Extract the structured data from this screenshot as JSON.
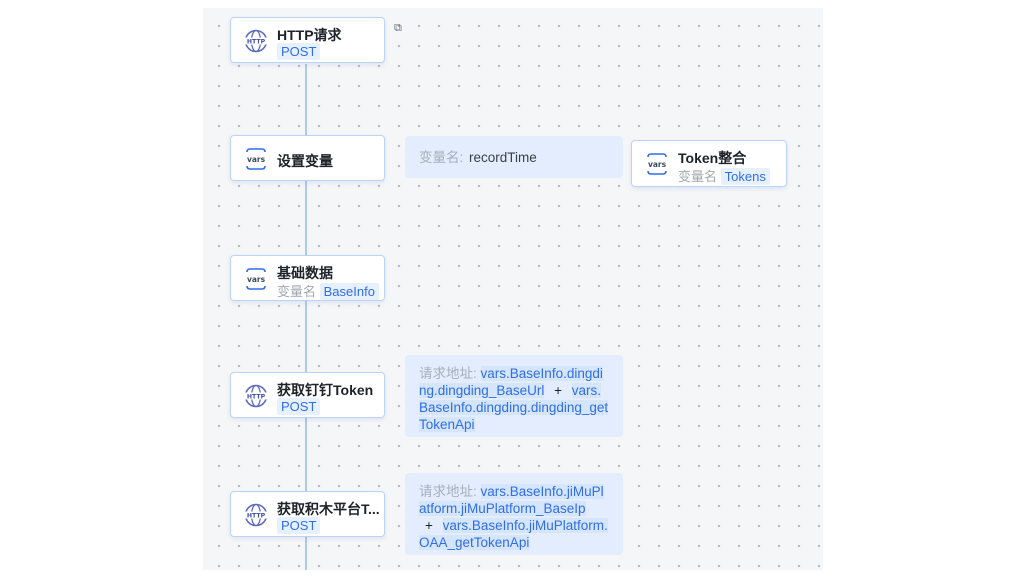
{
  "canvas": {
    "background": "#f5f6f7",
    "accent": "#2f6ee6"
  },
  "nodes": {
    "http_request": {
      "title": "HTTP请求",
      "method": "POST",
      "icon": "http-globe-icon"
    },
    "set_variable": {
      "title": "设置变量",
      "icon": "vars-icon"
    },
    "token_merge": {
      "title": "Token整合",
      "var_label": "变量名",
      "var_value": "Tokens",
      "icon": "vars-icon"
    },
    "base_data": {
      "title": "基础数据",
      "var_label": "变量名",
      "var_value": "BaseInfo",
      "icon": "vars-icon"
    },
    "dingding_token": {
      "title": "获取钉钉Token",
      "method": "POST",
      "icon": "http-globe-icon"
    },
    "jimu_token": {
      "title": "获取积木平台T...",
      "method": "POST",
      "icon": "http-globe-icon"
    }
  },
  "panels": {
    "set_variable": {
      "label": "变量名:",
      "value": "recordTime"
    },
    "dingding": {
      "label": "请求地址:",
      "part1": "vars.BaseInfo.dingding.dingding_BaseUrl",
      "plus": "+",
      "part2": "vars.BaseInfo.dingding.dingding_getTokenApi"
    },
    "jimu": {
      "label": "请求地址:",
      "part1": "vars.BaseInfo.jiMuPlatform.jiMuPlatform_BaseIp",
      "plus": "+",
      "part2": "vars.BaseInfo.jiMuPlatform.OAA_getTokenApi"
    }
  }
}
